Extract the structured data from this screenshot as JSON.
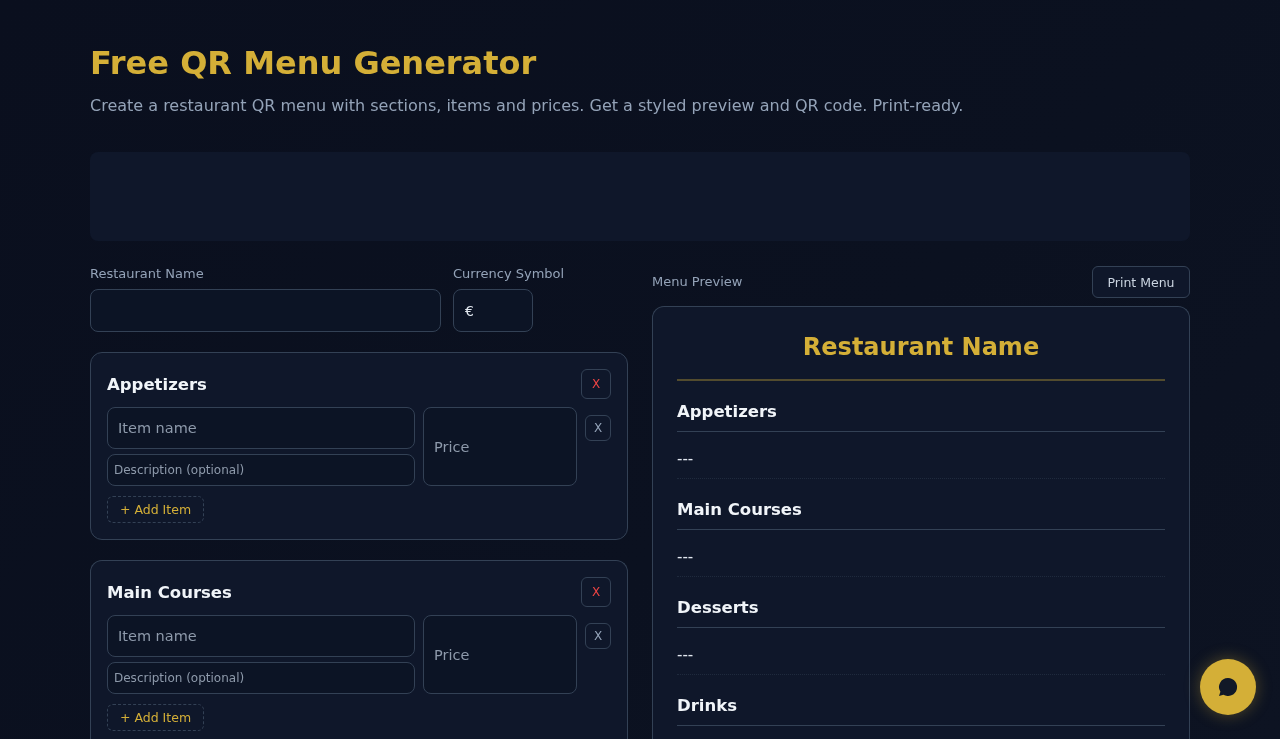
{
  "header": {
    "title": "Free QR Menu Generator",
    "subtitle": "Create a restaurant QR menu with sections, items and prices. Get a styled preview and QR code. Print-ready."
  },
  "settings": {
    "restaurant_name": {
      "label": "Restaurant Name"
    },
    "currency": {
      "label": "Currency Symbol",
      "value": "€"
    }
  },
  "sections": [
    {
      "title": "Appetizers",
      "remove": "X",
      "items": [
        {
          "name": {
            "placeholder": "Item name"
          },
          "description": {
            "placeholder": "Description (optional)"
          },
          "price": {
            "placeholder": "Price"
          },
          "remove": "X"
        }
      ],
      "add_item": "+ Add Item"
    },
    {
      "title": "Main Courses",
      "remove": "X",
      "items": [
        {
          "name": {
            "placeholder": "Item name"
          },
          "description": {
            "placeholder": "Description (optional)"
          },
          "price": {
            "placeholder": "Price"
          },
          "remove": "X"
        }
      ],
      "add_item": "+ Add Item"
    }
  ],
  "preview": {
    "label": "Menu Preview",
    "print_button": "Print Menu",
    "title": "Restaurant Name",
    "sections": [
      {
        "title": "Appetizers",
        "empty_text": "---"
      },
      {
        "title": "Main Courses",
        "empty_text": "---"
      },
      {
        "title": "Desserts",
        "empty_text": "---"
      },
      {
        "title": "Drinks"
      }
    ]
  }
}
